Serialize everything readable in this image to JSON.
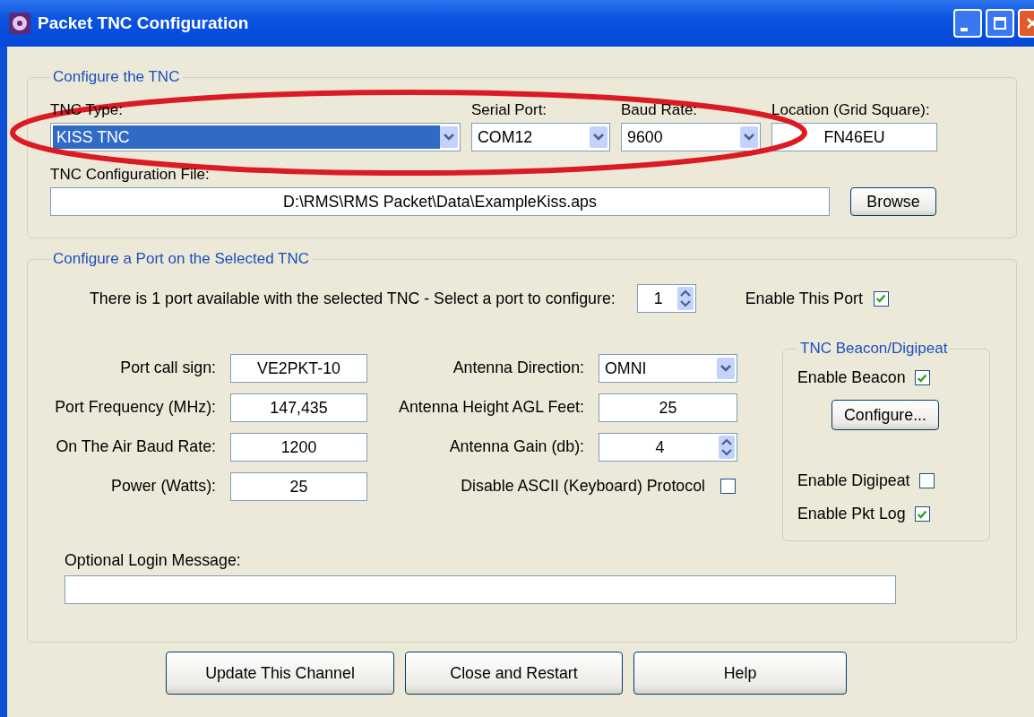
{
  "window": {
    "title": "Packet TNC Configuration"
  },
  "tnc_group": {
    "legend": "Configure the TNC",
    "selectors": [
      {
        "label": "TNC Type:",
        "value": "KISS TNC",
        "highlighted": true
      },
      {
        "label": "Serial Port:",
        "value": "COM12",
        "highlighted": false
      },
      {
        "label": "Baud Rate:",
        "value": "9600",
        "highlighted": false
      }
    ],
    "location": {
      "label": "Location (Grid Square):",
      "value": "FN46EU"
    },
    "config_file": {
      "label": "TNC Configuration File:",
      "value": "D:\\RMS\\RMS Packet\\Data\\ExampleKiss.aps"
    },
    "browse_button": "Browse"
  },
  "port_group": {
    "legend": "Configure a Port on the Selected TNC",
    "port_prompt": "There is 1 port available with the selected TNC - Select a port to configure:",
    "port_number": "1",
    "enable_port": {
      "label": "Enable This Port",
      "checked": true
    },
    "left_fields": [
      {
        "label": "Port call sign:",
        "value": "VE2PKT-10"
      },
      {
        "label": "Port Frequency (MHz):",
        "value": "147,435"
      },
      {
        "label": "On The Air Baud Rate:",
        "value": "1200"
      },
      {
        "label": "Power (Watts):",
        "value": "25"
      }
    ],
    "right_fields": [
      {
        "kind": "dropdown",
        "label": "Antenna Direction:",
        "value": "OMNI"
      },
      {
        "kind": "text",
        "label": "Antenna Height AGL Feet:",
        "value": "25"
      },
      {
        "kind": "spinner",
        "label": "Antenna Gain (db):",
        "value": "4"
      },
      {
        "kind": "checkbox",
        "label": "Disable ASCII (Keyboard) Protocol",
        "checked": false
      }
    ],
    "beacon": {
      "legend": "TNC Beacon/Digipeat",
      "items": [
        {
          "kind": "checkbox",
          "label": "Enable Beacon",
          "checked": true
        },
        {
          "kind": "button",
          "label": "Configure..."
        },
        {
          "kind": "checkbox",
          "label": "Enable Digipeat",
          "checked": false
        },
        {
          "kind": "checkbox",
          "label": "Enable Pkt Log",
          "checked": true
        }
      ]
    },
    "login": {
      "label": "Optional Login Message:"
    }
  },
  "buttons": [
    "Update This Channel",
    "Close and Restart",
    "Help"
  ]
}
